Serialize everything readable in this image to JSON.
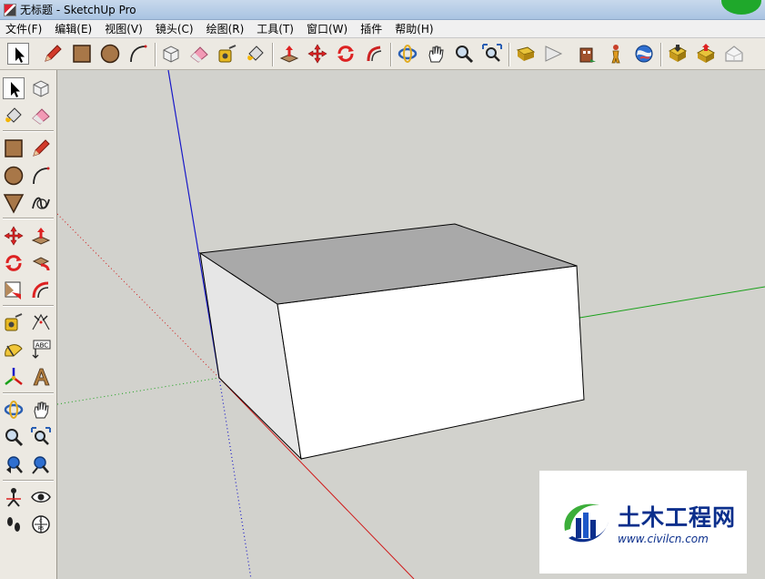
{
  "window": {
    "title": "无标题 - SketchUp Pro"
  },
  "menu": {
    "items": [
      "文件(F)",
      "编辑(E)",
      "视图(V)",
      "镜头(C)",
      "绘图(R)",
      "工具(T)",
      "窗口(W)",
      "插件",
      "帮助(H)"
    ]
  },
  "toolbar": {
    "tools": [
      "select",
      "pencil",
      "rectangle",
      "circle",
      "arc",
      "make-component",
      "eraser",
      "tape-measure",
      "paint-bucket",
      "push-pull",
      "move",
      "rotate",
      "follow-me",
      "orbit",
      "pan",
      "zoom",
      "zoom-extents",
      "add-location",
      "toggle-terrain",
      "photo-textures",
      "get-models",
      "share-model",
      "share-component",
      "google-earth",
      "warehouse-download",
      "warehouse-upload",
      "preview-google-earth"
    ]
  },
  "left_toolbar": {
    "tools": [
      "select",
      "make-component",
      "paint-bucket",
      "eraser",
      "rectangle",
      "line",
      "circle",
      "arc",
      "polygon",
      "freehand",
      "move",
      "push-pull",
      "rotate",
      "follow-me",
      "scale",
      "offset",
      "tape-measure",
      "dimension",
      "protractor",
      "text",
      "axes",
      "3d-text",
      "orbit",
      "pan",
      "zoom",
      "zoom-window",
      "previous",
      "zoom-extents",
      "position-camera",
      "look-around",
      "walk",
      "section-plane"
    ]
  },
  "watermark": {
    "name": "土木工程网",
    "url": "www.civilcn.com"
  },
  "colors": {
    "axis_red": "#d01818",
    "axis_green": "#18a018",
    "axis_blue": "#1818c8",
    "viewport_bg": "#d2d2cd",
    "box_top": "#a9a9a9",
    "box_front": "#ffffff",
    "box_left": "#e6e6e6",
    "watermark_blue": "#0b2f8c",
    "watermark_green": "#3cae3a"
  }
}
